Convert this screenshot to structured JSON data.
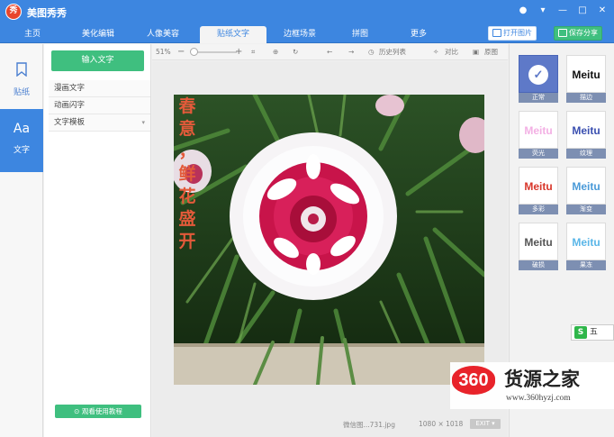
{
  "app": {
    "logo_text": "秀",
    "title": "美图秀秀"
  },
  "window_controls": [
    "message-icon",
    "menu-dropdown-icon",
    "minimize-icon",
    "maximize-icon",
    "close-icon"
  ],
  "nav": {
    "tabs": [
      {
        "label": "主页"
      },
      {
        "label": "美化编辑"
      },
      {
        "label": "人像美容"
      },
      {
        "label": "贴纸文字",
        "active": true
      },
      {
        "label": "边框场景"
      },
      {
        "label": "拼图"
      },
      {
        "label": "更多"
      }
    ],
    "open_label": "打开图片",
    "save_label": "保存分享"
  },
  "sidebar": {
    "items": [
      {
        "label": "贴纸",
        "icon": "bookmark-icon"
      },
      {
        "label": "文字",
        "icon": "text-aa-icon",
        "icon_glyph": "Aa",
        "active": true
      }
    ]
  },
  "panel": {
    "input_button": "输入文字",
    "menu": [
      "漫画文字",
      "动画闪字",
      "文字模板"
    ],
    "tutorial_button": "观看使用教程"
  },
  "toolbar": {
    "zoom": "51%",
    "history_label": "历史列表",
    "compare_label": "对比",
    "original_label": "原图"
  },
  "canvas": {
    "overlay_text": [
      "春",
      "意",
      "，",
      "鲜",
      "花",
      "盛",
      "开"
    ],
    "file_name": "微信图...731.jpg",
    "dimensions": "1080 × 1018",
    "exit_label": "EXIT"
  },
  "styles": {
    "sample_text": "Meitu",
    "tiles": [
      {
        "label": "正常",
        "selected": true
      },
      {
        "label": "描边"
      },
      {
        "label": "荧光"
      },
      {
        "label": "纹理"
      },
      {
        "label": "多彩"
      },
      {
        "label": "渐变"
      },
      {
        "label": "破损"
      },
      {
        "label": "果冻"
      }
    ]
  },
  "ime_badge": {
    "icon": "S",
    "text": "五"
  },
  "watermark": {
    "logo": "360",
    "name": "货源之家",
    "url": "www.360hyzj.com"
  },
  "colors": {
    "accent_blue": "#3d86e0",
    "accent_green": "#3fbf7f",
    "overlay_text": "#e35a3a",
    "tile_label": "#7d8fb2"
  }
}
